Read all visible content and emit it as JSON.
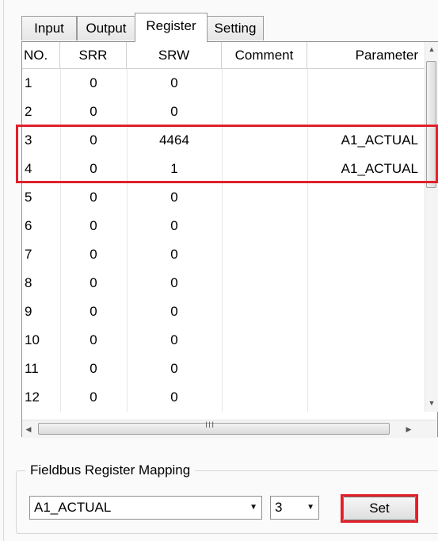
{
  "tabs": [
    {
      "label": "Input"
    },
    {
      "label": "Output"
    },
    {
      "label": "Register"
    },
    {
      "label": "Setting"
    }
  ],
  "active_tab": "Register",
  "table": {
    "columns": [
      "NO.",
      "SRR",
      "SRW",
      "Comment",
      "Parameter"
    ],
    "rows": [
      {
        "no": "1",
        "srr": "0",
        "srw": "0",
        "comment": "",
        "parameter": ""
      },
      {
        "no": "2",
        "srr": "0",
        "srw": "0",
        "comment": "",
        "parameter": ""
      },
      {
        "no": "3",
        "srr": "0",
        "srw": "4464",
        "comment": "",
        "parameter": "A1_ACTUAL"
      },
      {
        "no": "4",
        "srr": "0",
        "srw": "1",
        "comment": "",
        "parameter": "A1_ACTUAL"
      },
      {
        "no": "5",
        "srr": "0",
        "srw": "0",
        "comment": "",
        "parameter": ""
      },
      {
        "no": "6",
        "srr": "0",
        "srw": "0",
        "comment": "",
        "parameter": ""
      },
      {
        "no": "7",
        "srr": "0",
        "srw": "0",
        "comment": "",
        "parameter": ""
      },
      {
        "no": "8",
        "srr": "0",
        "srw": "0",
        "comment": "",
        "parameter": ""
      },
      {
        "no": "9",
        "srr": "0",
        "srw": "0",
        "comment": "",
        "parameter": ""
      },
      {
        "no": "10",
        "srr": "0",
        "srw": "0",
        "comment": "",
        "parameter": ""
      },
      {
        "no": "11",
        "srr": "0",
        "srw": "0",
        "comment": "",
        "parameter": ""
      },
      {
        "no": "12",
        "srr": "0",
        "srw": "0",
        "comment": "",
        "parameter": ""
      }
    ],
    "hscroll_grip": "III"
  },
  "fieldbus": {
    "title": "Fieldbus Register Mapping",
    "parameter_select": "A1_ACTUAL",
    "register_select": "3",
    "set_label": "Set"
  },
  "colors": {
    "highlight": "#e1202a"
  },
  "icons": {
    "scroll_up": "scroll-up-arrow-icon",
    "scroll_down": "scroll-down-arrow-icon",
    "scroll_left": "scroll-left-arrow-icon",
    "scroll_right": "scroll-right-arrow-icon",
    "dropdown": "chevron-down-icon"
  }
}
